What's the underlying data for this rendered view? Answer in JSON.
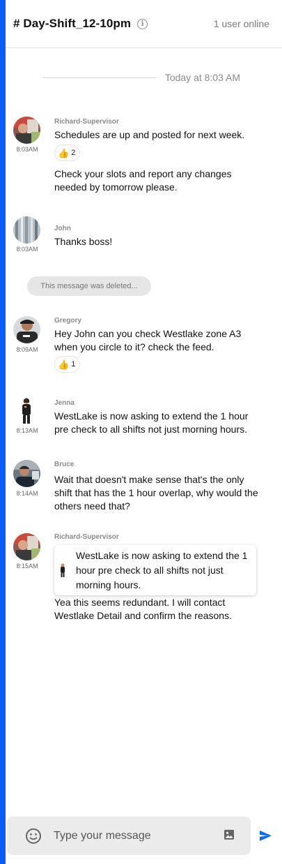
{
  "colors": {
    "accent": "#0a5cff",
    "text": "#111111",
    "muted": "#8a8a8a"
  },
  "header": {
    "channel_title": "# Day-Shift_12-10pm",
    "info_icon": "info-icon",
    "online_status": "1 user online"
  },
  "date_separator": "Today at 8:03 AM",
  "deleted_notice": "This message was deleted...",
  "messages": [
    {
      "author": "Richard-Supervisor",
      "time": "8:03AM",
      "text": "Schedules are up and posted for next week.",
      "reaction": {
        "icon": "thumbs-up-icon",
        "count": "2"
      },
      "followup": "Check your slots and report any changes needed by tomorrow please."
    },
    {
      "author": "John",
      "time": "8:03AM",
      "text": "Thanks boss!"
    },
    {
      "author": "Gregory",
      "time": "8:09AM",
      "text": "Hey John can you check Westlake zone A3 when you circle to it? check the feed.",
      "reaction": {
        "icon": "thumbs-up-icon",
        "count": "1"
      }
    },
    {
      "author": "Jenna",
      "time": "8:13AM",
      "text": "WestLake is now asking to extend the 1 hour pre check to all shifts not just morning hours."
    },
    {
      "author": "Bruce",
      "time": "8:14AM",
      "text": "Wait that doesn't make sense that's the only shift that has the 1 hour overlap, why would the others need that?"
    },
    {
      "author": "Richard-Supervisor",
      "time": "8:15AM",
      "quote": "WestLake is now asking to extend the 1 hour pre check to all shifts not just morning hours.",
      "text": "Yea this seems redundant. I will contact Westlake Detail and confirm the reasons."
    }
  ],
  "composer": {
    "placeholder": "Type your message",
    "emoji_icon": "emoji-icon",
    "image_icon": "image-icon",
    "send_icon": "send-icon"
  }
}
